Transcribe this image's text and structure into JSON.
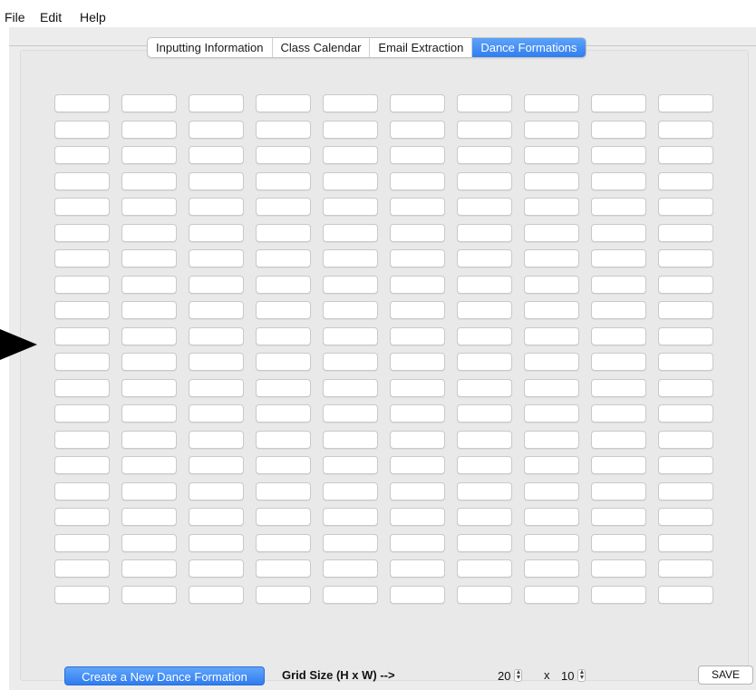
{
  "menu": {
    "file": "File",
    "edit": "Edit",
    "help": "Help"
  },
  "tabs": [
    {
      "label": "Inputting Information",
      "active": false
    },
    {
      "label": "Class Calendar",
      "active": false
    },
    {
      "label": "Email Extraction",
      "active": false
    },
    {
      "label": "Dance Formations",
      "active": true
    }
  ],
  "formation_grid": {
    "rows": 20,
    "columns": 10
  },
  "controls": {
    "create_button": "Create a New Dance Formation",
    "grid_size_label": "Grid Size (H x W) -->",
    "height_value": "20",
    "times_label": "x",
    "width_value": "10",
    "save_button": "SAVE"
  },
  "colors": {
    "accent": "#2f7ef0",
    "panel": "#e9e9e9"
  }
}
